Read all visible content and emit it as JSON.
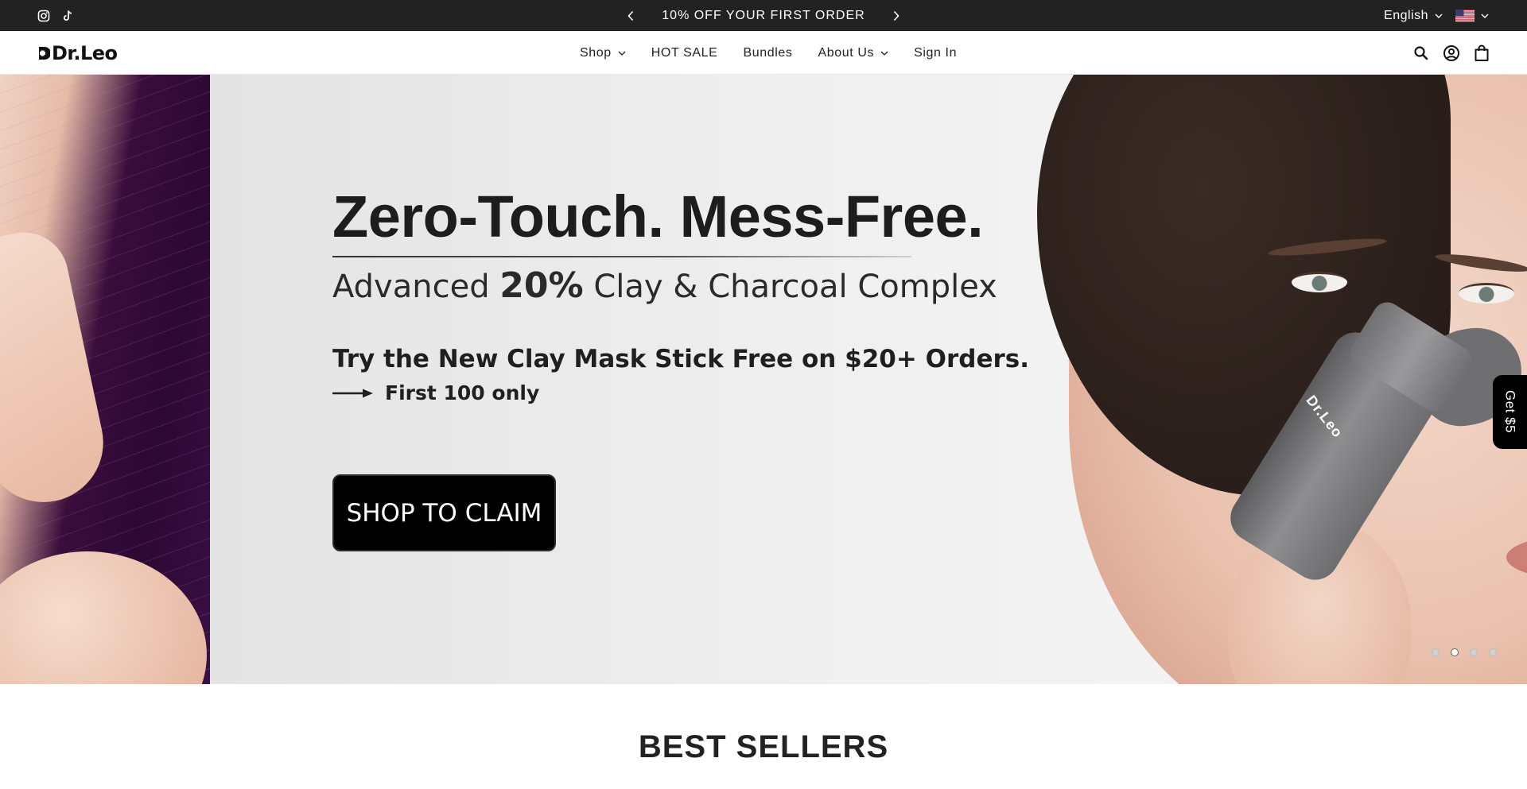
{
  "announcement": {
    "text": "10% OFF YOUR FIRST ORDER",
    "social_icons": [
      "instagram-icon",
      "tiktok-icon"
    ]
  },
  "locale": {
    "language": "English",
    "country_flag": "us-flag-icon"
  },
  "header": {
    "logo_text": "Dr.Leo",
    "nav": [
      {
        "label": "Shop",
        "has_dropdown": true
      },
      {
        "label": "HOT SALE",
        "has_dropdown": false
      },
      {
        "label": "Bundles",
        "has_dropdown": false
      },
      {
        "label": "About Us",
        "has_dropdown": true
      },
      {
        "label": "Sign In",
        "has_dropdown": false
      }
    ],
    "icons": [
      "search-icon",
      "account-icon",
      "cart-icon"
    ]
  },
  "hero": {
    "headline": "Zero-Touch. Mess-Free.",
    "subhead_pre": "Advanced ",
    "subhead_bold": "20%",
    "subhead_post": " Clay & Charcoal Complex",
    "offer": "Try the New Clay Mask Stick Free on $20+ Orders.",
    "limit": "First 100 only",
    "cta": "SHOP TO CLAIM",
    "product_label": "Dr.Leo",
    "slides_count": 4,
    "active_slide": 2
  },
  "side_tab": {
    "label": "Get $5"
  },
  "section": {
    "title": "BEST SELLERS"
  },
  "colors": {
    "topbar_bg": "#222222",
    "cta_bg": "#000000",
    "text": "#222222"
  }
}
